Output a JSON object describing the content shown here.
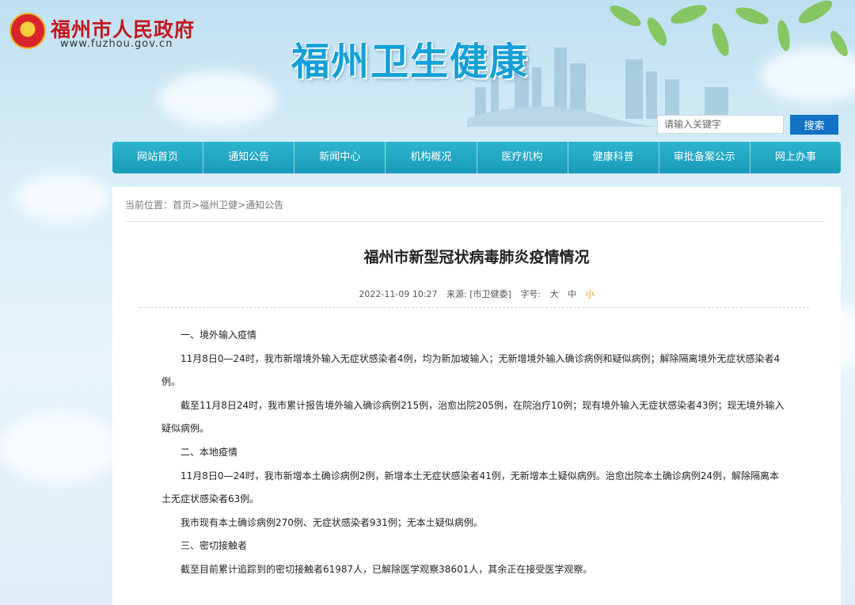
{
  "header": {
    "gov_name": "福州市人民政府",
    "gov_url": "www.fuzhou.gov.cn",
    "site_title": "福州卫生健康"
  },
  "search": {
    "placeholder": "请输入关键字",
    "button_label": "搜索"
  },
  "nav": {
    "items": [
      "网站首页",
      "通知公告",
      "新闻中心",
      "机构概况",
      "医疗机构",
      "健康科普",
      "审批备案公示",
      "网上办事"
    ]
  },
  "breadcrumb": {
    "prefix": "当前位置：",
    "home": "首页",
    "sep1": ">",
    "section": "福州卫健",
    "sep2": ">",
    "current": "通知公告"
  },
  "article": {
    "title": "福州市新型冠状病毒肺炎疫情情况",
    "date": "2022-11-09 10:27",
    "source": "来源: [市卫健委]",
    "size_label": "字号:",
    "size_large": "大",
    "size_medium": "中",
    "size_small": "小",
    "paragraphs": [
      "一、境外输入疫情",
      "11月8日0—24时，我市新增境外输入无症状感染者4例，均为新加坡输入；无新增境外输入确诊病例和疑似病例；解除隔离境外无症状感染者4例。",
      "截至11月8日24时，我市累计报告境外输入确诊病例215例，治愈出院205例，在院治疗10例；现有境外输入无症状感染者43例；现无境外输入疑似病例。",
      "二、本地疫情",
      "11月8日0—24时，我市新增本土确诊病例2例，新增本土无症状感染者41例，无新增本土疑似病例。治愈出院本土确诊病例24例，解除隔离本土无症状感染者63例。",
      "我市现有本土确诊病例270例、无症状感染者931例；无本土疑似病例。",
      "三、密切接触者",
      "截至目前累计追踪到的密切接触者61987人，已解除医学观察38601人，其余正在接受医学观察。"
    ]
  },
  "colors": {
    "nav": "#1fa6c2",
    "search_button": "#1273c6",
    "title_blue": "#12a0d8",
    "gov_red": "#c5161d",
    "size_active": "#e08a00"
  }
}
